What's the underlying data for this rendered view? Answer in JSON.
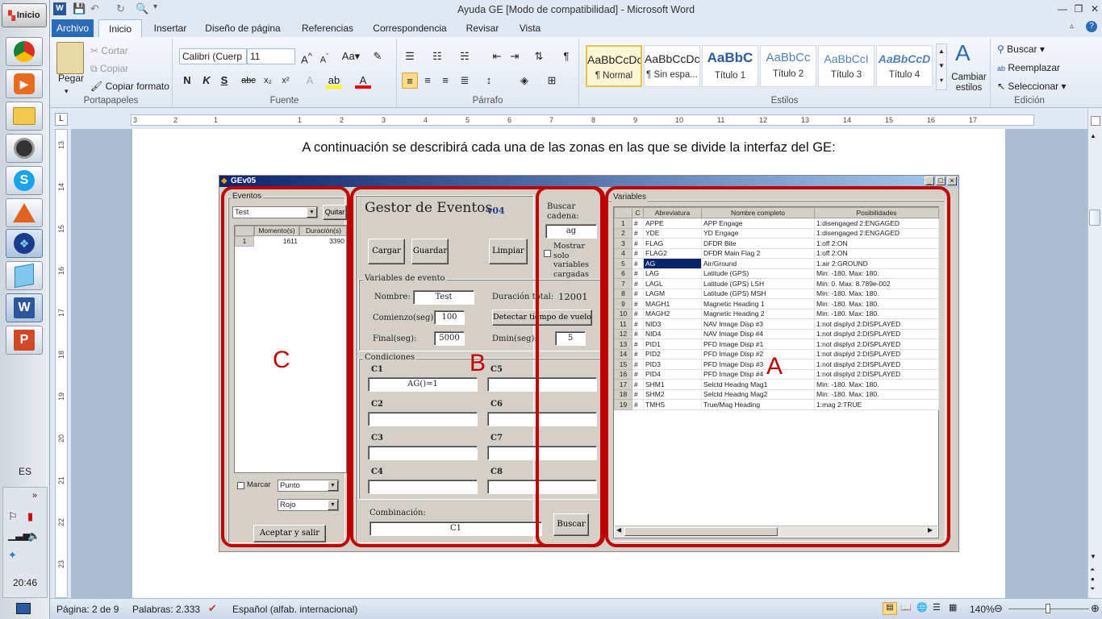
{
  "taskbar": {
    "start_label": "Inicio",
    "apps": [
      "chrome-icon",
      "media-player-icon",
      "file-explorer-icon",
      "utility-icon",
      "skype-icon",
      "matlab-icon",
      "windows-logo-icon",
      "notepad-icon",
      "word-icon",
      "powerpoint-icon"
    ],
    "language": "ES",
    "clock": "20:46"
  },
  "window": {
    "title": "Ayuda GE [Modo de compatibilidad]  -  Microsoft Word"
  },
  "ribbon": {
    "tabs": [
      "Archivo",
      "Inicio",
      "Insertar",
      "Diseño de página",
      "Referencias",
      "Correspondencia",
      "Revisar",
      "Vista"
    ],
    "clipboard": {
      "paste": "Pegar",
      "cut": "Cortar",
      "copy": "Copiar",
      "format_painter": "Copiar formato",
      "group": "Portapapeles"
    },
    "font": {
      "name": "Calibri (Cuerp",
      "size": "11",
      "group": "Fuente"
    },
    "paragraph": {
      "group": "Párrafo"
    },
    "styles": {
      "group": "Estilos",
      "items": [
        {
          "sample": "AaBbCcDc",
          "name": "¶ Normal"
        },
        {
          "sample": "AaBbCcDc",
          "name": "¶ Sin espa..."
        },
        {
          "sample": "AaBbC",
          "name": "Título 1"
        },
        {
          "sample": "AaBbCc",
          "name": "Título 2"
        },
        {
          "sample": "AaBbCcI",
          "name": "Título 3"
        },
        {
          "sample": "AaBbCcD",
          "name": "Título 4"
        }
      ],
      "change": "Cambiar estilos"
    },
    "editing": {
      "group": "Edición",
      "find": "Buscar",
      "replace": "Reemplazar",
      "select": "Seleccionar"
    }
  },
  "ruler": {
    "h_ticks": [
      "3",
      "2",
      "1",
      "1",
      "2",
      "3",
      "4",
      "5",
      "6",
      "7",
      "8",
      "9",
      "10",
      "11",
      "12",
      "13",
      "14",
      "15",
      "16",
      "17"
    ],
    "v_ticks": [
      "13",
      "14",
      "15",
      "16",
      "17",
      "18",
      "19",
      "20",
      "21",
      "22",
      "23",
      "24"
    ]
  },
  "document": {
    "paragraph": "A continuación se describirá cada una de las zonas en las que se divide la interfaz del GE:"
  },
  "gev": {
    "title": "GEv05",
    "eventos": {
      "legend": "Eventos",
      "selected": "Test",
      "quitar": "Quitar",
      "columns": [
        "Momento(s)",
        "Duración(s)"
      ],
      "rows": [
        {
          "n": "1",
          "momento": "1611",
          "duracion": "3390"
        }
      ],
      "marcar": "Marcar",
      "punto": "Punto",
      "rojo": "Rojo",
      "aceptar": "Aceptar y salir"
    },
    "gestor": {
      "title": "Gestor de Eventos",
      "version": "v04",
      "cargar": "Cargar",
      "guardar": "Guardar",
      "limpiar": "Limpiar",
      "vars_legend": "Variables de evento",
      "nombre_label": "Nombre:",
      "nombre": "Test",
      "duracion_label": "Duración total:",
      "duracion": "12001",
      "comienzo_label": "Comienzo(seg):",
      "comienzo": "100",
      "detectar": "Detectar tiempo de vuelo",
      "final_label": "Final(seg):",
      "final": "5000",
      "dmin_label": "Dmin(seg):",
      "dmin": "5",
      "cond_legend": "Condiciones",
      "c1_label": "C1",
      "c1": "AG()=1",
      "c2_label": "C2",
      "c2": "",
      "c3_label": "C3",
      "c3": "",
      "c4_label": "C4",
      "c4": "",
      "c5_label": "C5",
      "c5": "",
      "c6_label": "C6",
      "c6": "",
      "c7_label": "C7",
      "c7": "",
      "c8_label": "C8",
      "c8": "",
      "combinacion_label": "Combinación:",
      "combinacion": "C1"
    },
    "buscar": {
      "label": "Buscar cadena:",
      "value": "ag",
      "mostrar": "Mostrar solo variables cargadas",
      "button": "Buscar"
    },
    "variables": {
      "legend": "Variables",
      "columns": [
        "C",
        "Abreviatura",
        "Nombre completo",
        "Posibilidades"
      ],
      "rows": [
        {
          "n": "1",
          "c": "#",
          "abbr": "APPE",
          "name": "APP Engage",
          "pos": "1:disengaged 2:ENGAGED"
        },
        {
          "n": "2",
          "c": "#",
          "abbr": "YDE",
          "name": "YD Engage",
          "pos": "1:disengaged 2:ENGAGED"
        },
        {
          "n": "3",
          "c": "#",
          "abbr": "FLAG",
          "name": "DFDR Bite",
          "pos": "1:off 2:ON"
        },
        {
          "n": "4",
          "c": "#",
          "abbr": "FLAG2",
          "name": "DFDR Main Flag 2",
          "pos": "1:off 2:ON"
        },
        {
          "n": "5",
          "c": "#",
          "abbr": "AG",
          "name": "Air/Ground",
          "pos": "1:air 2:GROUND"
        },
        {
          "n": "6",
          "c": "#",
          "abbr": "LAG",
          "name": "Latitude (GPS)",
          "pos": "Min: -180. Max: 180."
        },
        {
          "n": "7",
          "c": "#",
          "abbr": "LAGL",
          "name": "Latitude (GPS) LSH",
          "pos": "Min: 0. Max: 8.789e-002"
        },
        {
          "n": "8",
          "c": "#",
          "abbr": "LAGM",
          "name": "Latitude (GPS) MSH",
          "pos": "Min: -180. Max: 180."
        },
        {
          "n": "9",
          "c": "#",
          "abbr": "MAGH1",
          "name": "Magnetic Heading 1",
          "pos": "Min: -180. Max: 180."
        },
        {
          "n": "10",
          "c": "#",
          "abbr": "MAGH2",
          "name": "Magnetic Heading 2",
          "pos": "Min: -180. Max: 180."
        },
        {
          "n": "11",
          "c": "#",
          "abbr": "NID3",
          "name": "NAV Image Disp #3",
          "pos": "1:not displyd 2:DISPLAYED"
        },
        {
          "n": "12",
          "c": "#",
          "abbr": "NID4",
          "name": "NAV Image Disp #4",
          "pos": "1:not displyd 2:DISPLAYED"
        },
        {
          "n": "13",
          "c": "#",
          "abbr": "PID1",
          "name": "PFD Image Disp #1",
          "pos": "1:not displyd 2:DISPLAYED"
        },
        {
          "n": "14",
          "c": "#",
          "abbr": "PID2",
          "name": "PFD Image Disp #2",
          "pos": "1:not displyd 2:DISPLAYED"
        },
        {
          "n": "15",
          "c": "#",
          "abbr": "PID3",
          "name": "PFD Image Disp #3",
          "pos": "1:not displyd 2:DISPLAYED"
        },
        {
          "n": "16",
          "c": "#",
          "abbr": "PID4",
          "name": "PFD Image Disp #4",
          "pos": "1:not displyd 2:DISPLAYED"
        },
        {
          "n": "17",
          "c": "#",
          "abbr": "SHM1",
          "name": "Selctd Headng Mag1",
          "pos": "Min: -180. Max: 180."
        },
        {
          "n": "18",
          "c": "#",
          "abbr": "SHM2",
          "name": "Selctd Headng Mag2",
          "pos": "Min: -180. Max: 180."
        },
        {
          "n": "19",
          "c": "#",
          "abbr": "TMHS",
          "name": "True/Mag Heading",
          "pos": "1:mag 2:TRUE"
        }
      ],
      "highlighted_row": 5
    },
    "annotations": {
      "a": "A",
      "b": "B",
      "c": "C",
      "color": "#c00000"
    }
  },
  "status": {
    "page": "Página: 2 de 9",
    "words": "Palabras: 2.333",
    "language": "Español (alfab. internacional)",
    "zoom": "140%"
  }
}
